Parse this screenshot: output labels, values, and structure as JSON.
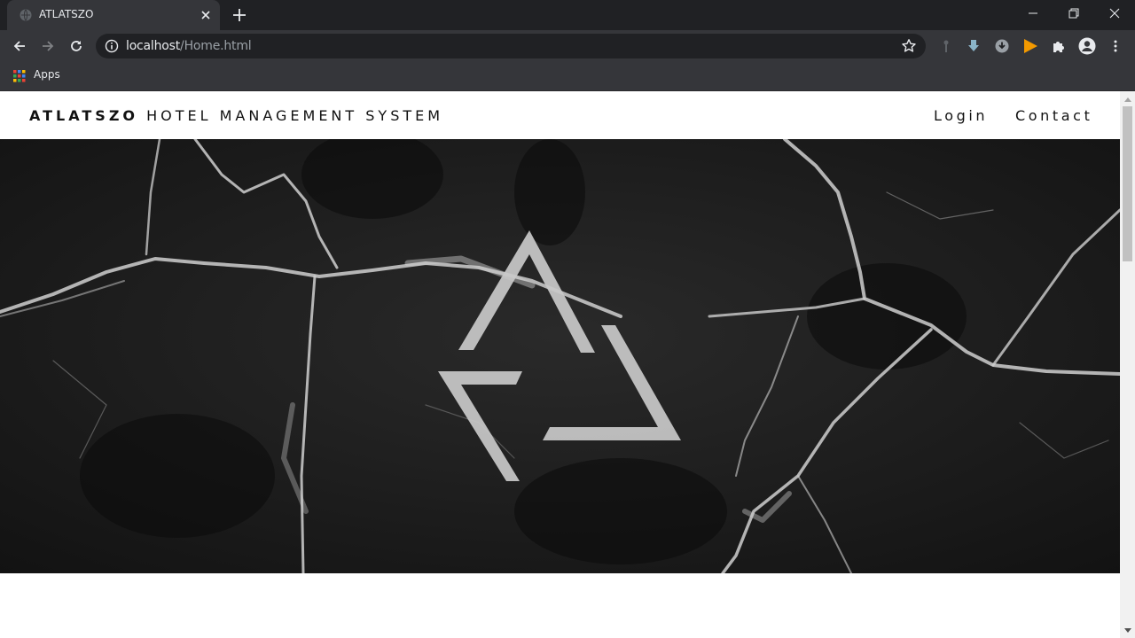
{
  "browser": {
    "tab": {
      "title": "ATLATSZO"
    },
    "url": {
      "host": "localhost",
      "path": "/Home.html"
    },
    "bookmarks": {
      "apps_label": "Apps"
    }
  },
  "site": {
    "brand": {
      "bold": "ATLATSZO",
      "rest": " HOTEL MANAGEMENT SYSTEM"
    },
    "nav": {
      "login": "Login",
      "contact": "Contact"
    }
  },
  "colors": {
    "chrome_dark": "#202124",
    "chrome_toolbar": "#35363a",
    "hero_bg": "#1a1a1a",
    "logo": "#c8c8c8",
    "accent_play": "#f29900"
  }
}
